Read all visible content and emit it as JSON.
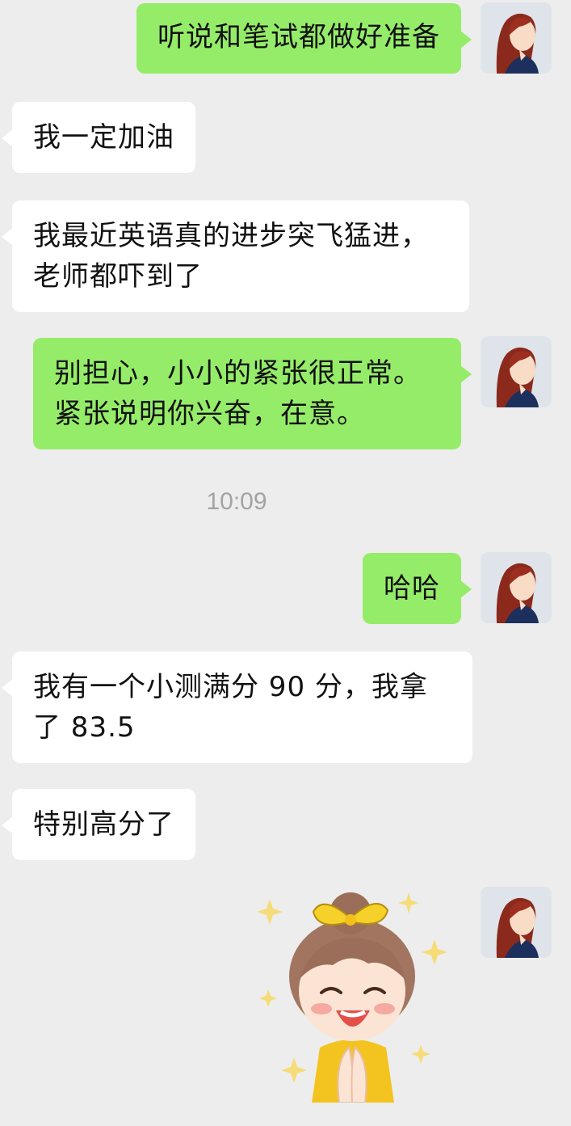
{
  "messages": [
    {
      "side": "out",
      "text": "听说和笔试都做好准备"
    },
    {
      "side": "in",
      "text": "我一定加油"
    },
    {
      "side": "in",
      "text": "我最近英语真的进步突飞猛进，\n老师都吓到了"
    },
    {
      "side": "out",
      "text": "别担心，小小的紧张很正常。\n紧张说明你兴奋，在意。"
    },
    {
      "side": "out",
      "text": "哈哈"
    },
    {
      "side": "in",
      "text": "我有一个小测满分 90 分，我拿\n了 83.5"
    },
    {
      "side": "in",
      "text": "特别高分了"
    },
    {
      "side": "out",
      "type": "sticker",
      "sticker": "girl-praying-happy-sticker"
    }
  ],
  "timestamp": "10:09",
  "colors": {
    "background": "#ededed",
    "outgoing_bubble": "#95ec69",
    "incoming_bubble": "#ffffff",
    "timestamp_text": "#a3a3a3"
  },
  "avatar_icon": "woman-portrait-avatar"
}
